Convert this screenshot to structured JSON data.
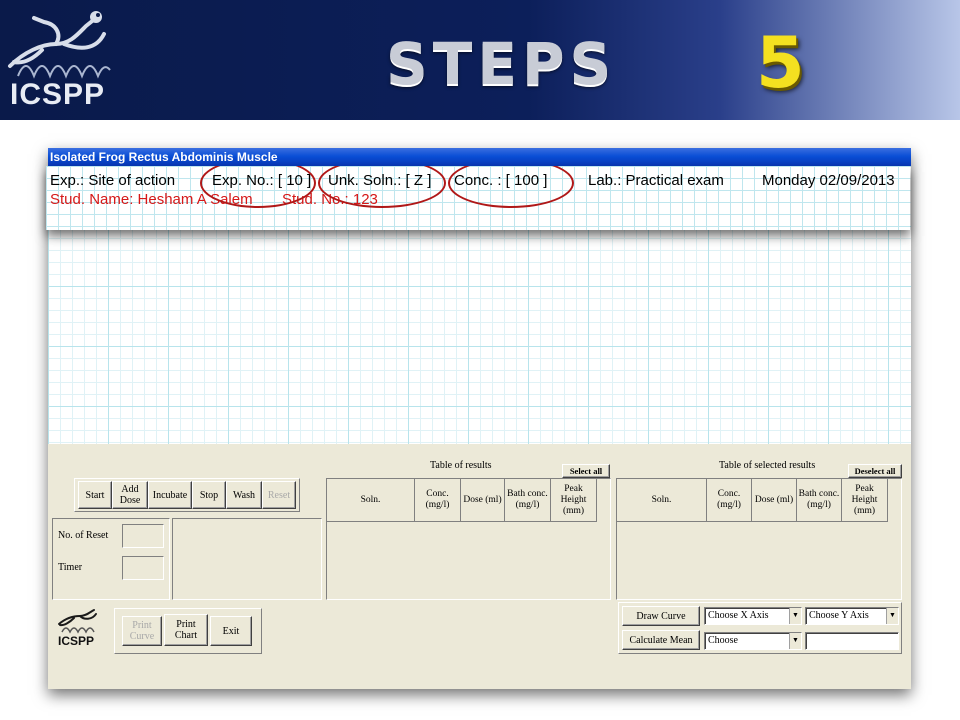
{
  "slide": {
    "logo_text": "ICSPP",
    "title": "STEPS",
    "step_number": "5"
  },
  "window": {
    "title": "Isolated Frog Rectus Abdominis Muscle"
  },
  "info_bar": {
    "experiment": "Exp.: Site of action",
    "exp_no": "Exp. No.: [ 10 ]",
    "unknown_solution": "Unk. Soln.:  [ Z ]",
    "concentration": "Conc. :  [ 100 ]",
    "lab": "Lab.: Practical exam",
    "date": "Monday  02/09/2013",
    "student_name": "Stud. Name: Hesham A Salem",
    "student_no": "Stud. No.: 123"
  },
  "controls": {
    "buttons": [
      {
        "label": "Start",
        "enabled": true
      },
      {
        "label": "Add Dose",
        "enabled": true
      },
      {
        "label": "Incubate",
        "enabled": true
      },
      {
        "label": "Stop",
        "enabled": true
      },
      {
        "label": "Wash",
        "enabled": true
      },
      {
        "label": "Reset",
        "enabled": false
      }
    ],
    "no_of_reset_label": "No. of Reset",
    "no_of_reset_value": "",
    "timer_label": "Timer",
    "timer_value": ""
  },
  "results_table": {
    "title": "Table of results",
    "action": "Select all",
    "columns": [
      "Soln.",
      "Conc. (mg/l)",
      "Dose (ml)",
      "Bath conc. (mg/l)",
      "Peak Height (mm)"
    ],
    "rows": []
  },
  "selected_table": {
    "title": "Table of selected results",
    "action": "Deselect all",
    "columns": [
      "Soln.",
      "Conc. (mg/l)",
      "Dose (ml)",
      "Bath conc. (mg/l)",
      "Peak Height (mm)"
    ],
    "rows": []
  },
  "footer": {
    "logo_text": "ICSPP",
    "print_curve": "Print Curve",
    "print_chart": "Print Chart",
    "exit": "Exit",
    "draw_curve": "Draw Curve",
    "calculate_mean": "Calculate Mean",
    "x_axis_select": "Choose X Axis",
    "y_axis_select": "Choose Y Axis",
    "mean_select": "Choose",
    "mean_value": ""
  },
  "colors": {
    "banner_dark": "#0a1a4a",
    "title_gray": "#c8ccd6",
    "step_yellow": "#f4e020",
    "highlight_red": "#b01818",
    "student_red": "#d61818",
    "window_face": "#ece9d8"
  },
  "icons": [
    "frog-logo-icon",
    "dropdown-arrow-icon"
  ]
}
